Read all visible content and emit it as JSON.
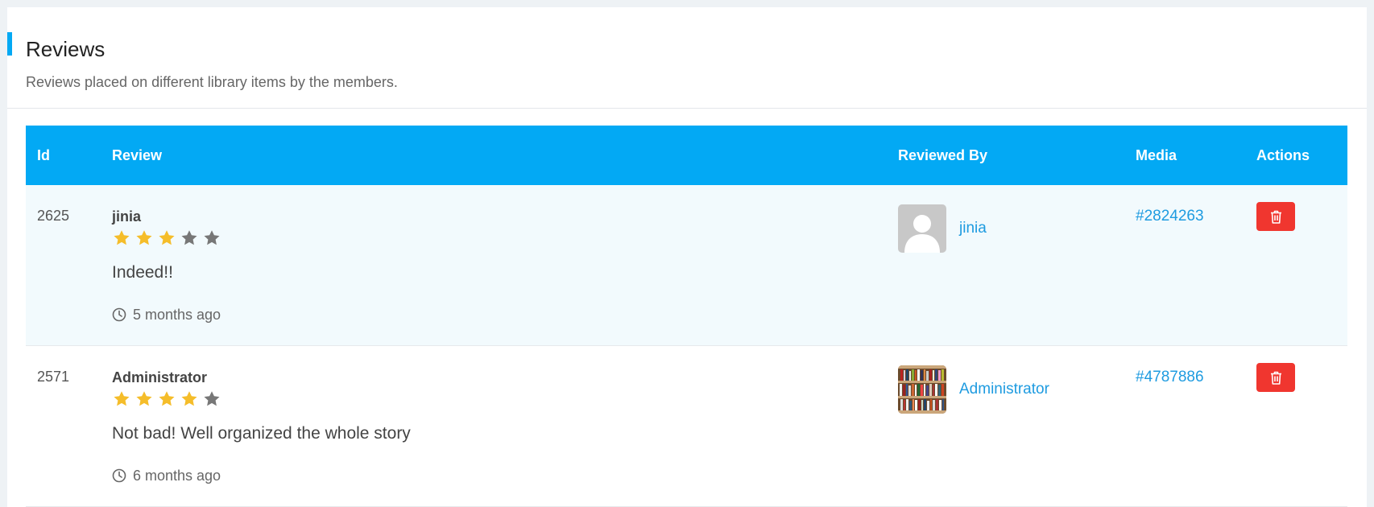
{
  "header": {
    "title": "Reviews",
    "subtitle": "Reviews placed on different library items by the members."
  },
  "colors": {
    "accent": "#03a9f4",
    "star_filled": "#f5bd2a",
    "star_empty": "#777777",
    "danger": "#f0362f",
    "link": "#1e9be0"
  },
  "table": {
    "columns": [
      "Id",
      "Review",
      "Reviewed By",
      "Media",
      "Actions"
    ],
    "rows": [
      {
        "id": "2625",
        "reviewer": "jinia",
        "rating": 3,
        "max_rating": 5,
        "text": "Indeed!!",
        "time": "5 months ago",
        "reviewed_by": "jinia",
        "avatar": "default-user-avatar",
        "media": "#2824263",
        "action_icon": "trash-icon"
      },
      {
        "id": "2571",
        "reviewer": "Administrator",
        "rating": 4,
        "max_rating": 5,
        "text": "Not bad! Well organized the whole story",
        "time": "6 months ago",
        "reviewed_by": "Administrator",
        "avatar": "bookshelf-photo-avatar",
        "media": "#4787886",
        "action_icon": "trash-icon"
      }
    ]
  }
}
